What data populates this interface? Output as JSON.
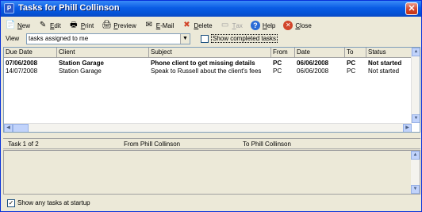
{
  "window": {
    "title": "Tasks for Phill Collinson",
    "close_glyph": "✕",
    "app_icon_glyph": "P"
  },
  "toolbar": {
    "buttons": [
      {
        "key": "N",
        "rest": "ew",
        "icon": "new-icon",
        "glyph": "📄",
        "disabled": false
      },
      {
        "key": "E",
        "rest": "dit",
        "icon": "edit-icon",
        "glyph": "✎",
        "disabled": false
      },
      {
        "key": "P",
        "rest": "rint",
        "icon": "print-icon",
        "glyph": "🖶",
        "disabled": false
      },
      {
        "key": "P",
        "rest": "review",
        "icon": "preview-icon",
        "glyph": "🖨",
        "disabled": false
      },
      {
        "key": "E",
        "rest": "-Mail",
        "icon": "email-icon",
        "glyph": "✉",
        "disabled": false
      },
      {
        "key": "D",
        "rest": "elete",
        "icon": "delete-icon",
        "glyph": "✖",
        "disabled": false
      },
      {
        "key": "T",
        "rest": "ax",
        "icon": "tax-icon",
        "glyph": "▭",
        "disabled": true
      },
      {
        "key": "H",
        "rest": "elp",
        "icon": "help-icon",
        "glyph": "?",
        "disabled": false
      },
      {
        "key": "C",
        "rest": "lose",
        "icon": "close-icon",
        "glyph": "✕",
        "disabled": false
      }
    ]
  },
  "view": {
    "label": "View",
    "selected": "tasks assigned to me",
    "show_completed_label": "Show completed tasks",
    "show_completed_checked": false
  },
  "grid": {
    "columns": [
      "Due Date",
      "Client",
      "Subject",
      "From",
      "Date",
      "To",
      "Status"
    ],
    "rows": [
      {
        "bold": true,
        "cells": [
          "07/06/2008",
          "Station Garage",
          "Phone client to get missing details",
          "PC",
          "06/06/2008",
          "PC",
          "Not started"
        ]
      },
      {
        "bold": false,
        "cells": [
          "14/07/2008",
          "Station Garage",
          "Speak to Russell about the client's fees",
          "PC",
          "06/06/2008",
          "PC",
          "Not started"
        ]
      }
    ]
  },
  "status": {
    "count": "Task 1 of 2",
    "from": "From Phill Collinson",
    "to": "To Phill Collinson"
  },
  "footer": {
    "show_at_startup_label": "Show any tasks at startup",
    "show_at_startup_checked": true
  },
  "colors": {
    "title_bar": "#0a5ce4",
    "window_bg": "#ece9d8",
    "close_button": "#d2452a"
  }
}
